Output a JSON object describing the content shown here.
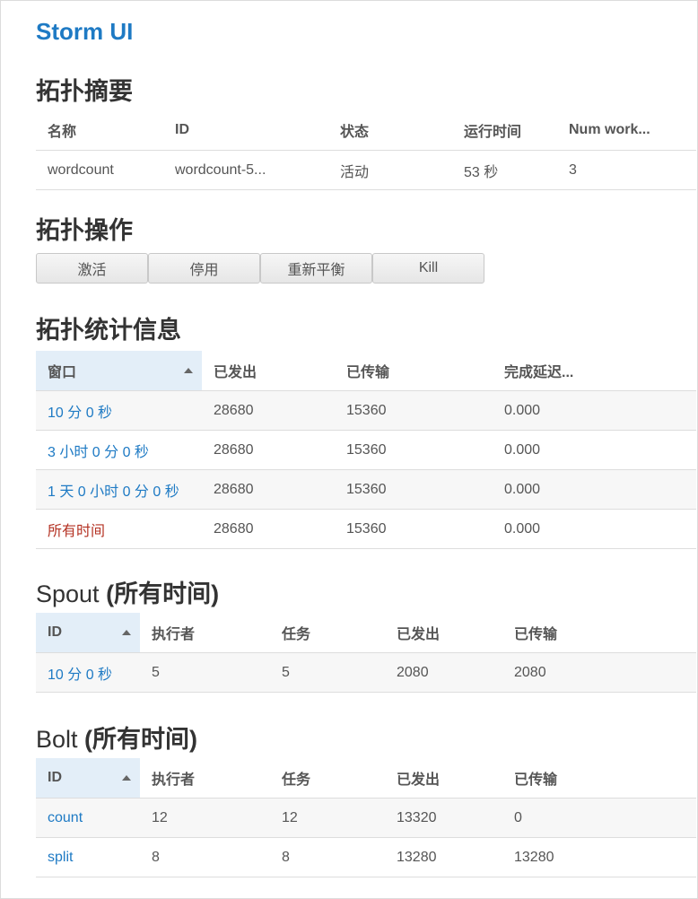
{
  "app": {
    "title": "Storm UI"
  },
  "summary": {
    "heading": "拓扑摘要",
    "columns": [
      "名称",
      "ID",
      "状态",
      "运行时间",
      "Num work..."
    ],
    "row": [
      "wordcount",
      "wordcount-5...",
      "活动",
      "53 秒",
      "3"
    ]
  },
  "actions": {
    "heading": "拓扑操作",
    "buttons": [
      "激活",
      "停用",
      "重新平衡",
      "Kill"
    ]
  },
  "stats": {
    "heading": "拓扑统计信息",
    "columns": [
      "窗口",
      "已发出",
      "已传输",
      "完成延迟..."
    ],
    "rows": [
      [
        "10 分 0 秒",
        "28680",
        "15360",
        "0.000"
      ],
      [
        "3 小时 0 分 0 秒",
        "28680",
        "15360",
        "0.000"
      ],
      [
        "1 天 0 小时 0 分 0 秒",
        "28680",
        "15360",
        "0.000"
      ],
      [
        "所有时间",
        "28680",
        "15360",
        "0.000"
      ]
    ]
  },
  "spout": {
    "heading_main": "Spout",
    "heading_sub": "(所有时间)",
    "columns": [
      "ID",
      "执行者",
      "任务",
      "已发出",
      "已传输"
    ],
    "rows": [
      [
        "10 分 0 秒",
        "5",
        "5",
        "2080",
        "2080"
      ]
    ]
  },
  "bolt": {
    "heading_main": "Bolt",
    "heading_sub": "(所有时间)",
    "columns": [
      "ID",
      "执行者",
      "任务",
      "已发出",
      "已传输"
    ],
    "rows": [
      [
        "count",
        "12",
        "12",
        "13320",
        "0"
      ],
      [
        "split",
        "8",
        "8",
        "13280",
        "13280"
      ]
    ]
  },
  "colors": {
    "brand": "#1e7ac4",
    "link": "#1e7ac4",
    "link_current": "#b43223",
    "sorted_header": "#e3eef8"
  },
  "icons": {
    "sort": "sort-ascending-icon"
  }
}
